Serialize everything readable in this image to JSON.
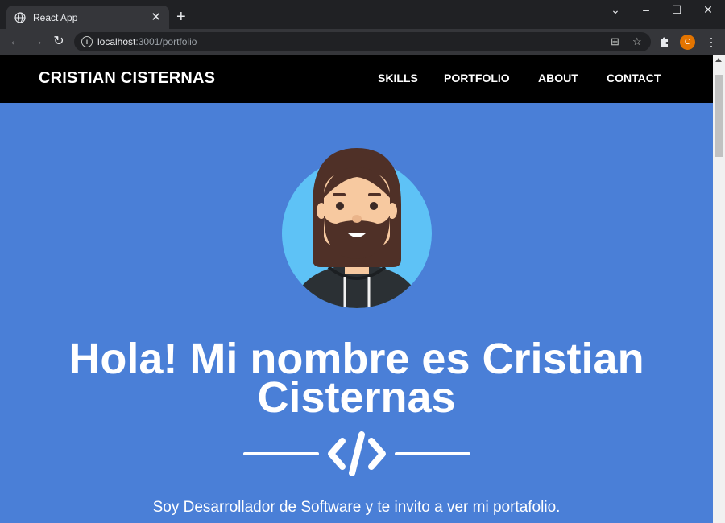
{
  "browser": {
    "tab_title": "React App",
    "url_host": "localhost",
    "url_rest": ":3001/portfolio",
    "profile_initial": "C"
  },
  "site": {
    "brand": "CRISTIAN CISTERNAS",
    "nav": [
      "SKILLS",
      "PORTFOLIO",
      "ABOUT",
      "CONTACT"
    ],
    "hero_title": "Hola! Mi nombre es Cristian Cisternas",
    "hero_text": "Soy Desarrollador de Software y te invito a ver mi portafolio."
  },
  "colors": {
    "navbar": "#000000",
    "hero_background": "#4a7fd7",
    "avatar_circle": "#5ec2f6",
    "hair": "#4f3027",
    "skin": "#f7c9a0"
  },
  "icons": [
    "globe-icon",
    "close-icon",
    "plus-icon",
    "back-icon",
    "forward-icon",
    "reload-icon",
    "info-icon",
    "translate-icon",
    "star-icon",
    "puzzle-icon",
    "code-icon"
  ]
}
